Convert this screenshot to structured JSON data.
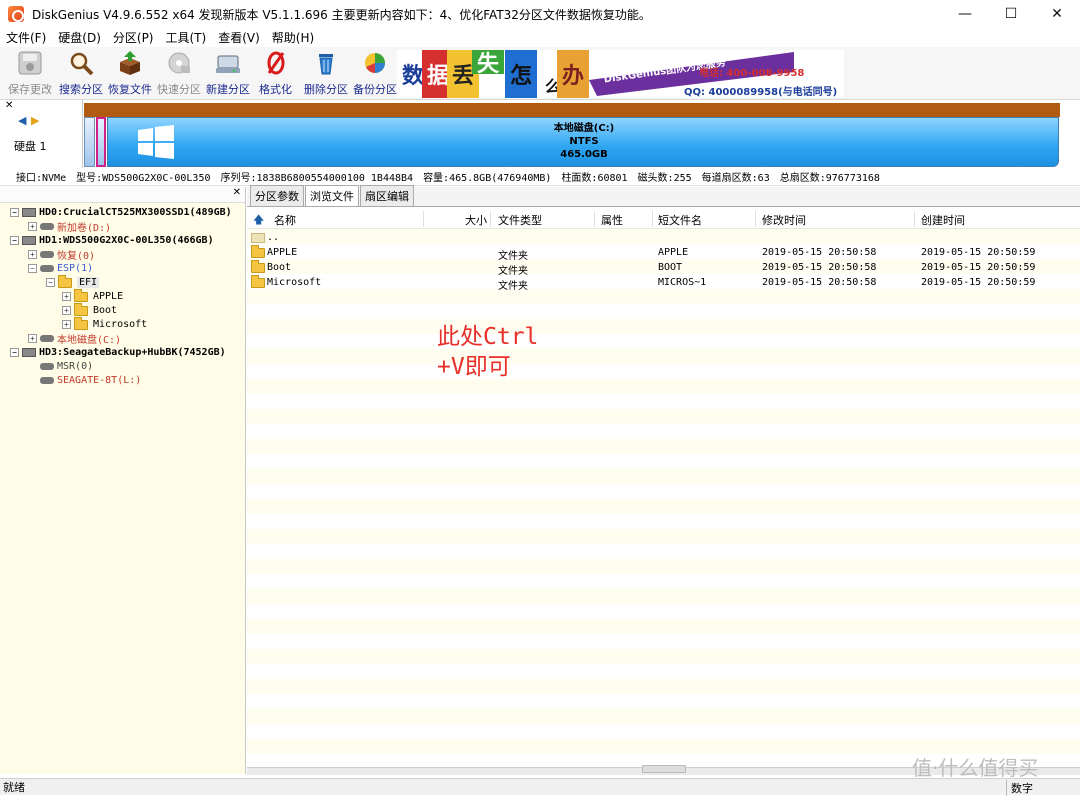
{
  "window": {
    "title": "DiskGenius V4.9.6.552 x64    发现新版本 V5.1.1.696 主要更新内容如下：4、优化FAT32分区文件数据恢复功能。",
    "min": "—",
    "max": "☐",
    "close": "✕"
  },
  "menu": [
    "文件(F)",
    "硬盘(D)",
    "分区(P)",
    "工具(T)",
    "查看(V)",
    "帮助(H)"
  ],
  "toolbar": {
    "save": "保存更改",
    "search": "搜索分区",
    "recover": "恢复文件",
    "quick": "快速分区",
    "new": "新建分区",
    "format": "格式化",
    "delete": "删除分区",
    "backup": "备份分区"
  },
  "banner": {
    "chars": [
      "数",
      "据",
      "丢",
      "失",
      "怎",
      "么",
      "办"
    ],
    "slogan": "DiskGenius团队为您服务",
    "phone": "电话: 400-008-9958",
    "qq": "QQ: 4000089958(与电话同号)"
  },
  "disk_label": "硬盘 1",
  "disk_nav": {
    "back": "◀",
    "forward": "▶"
  },
  "partition": {
    "name": "本地磁盘(C:)",
    "fs": "NTFS",
    "size": "465.0GB"
  },
  "disk_info": {
    "iface": "接口:NVMe",
    "model": "型号:WDS500G2X0C-00L350",
    "serial": "序列号:1838B6800554000100 1B448B4",
    "capacity": "容量:465.8GB(476940MB)",
    "cylinders": "柱面数:60801",
    "heads": "磁头数:255",
    "sectors_per_track": "每道扇区数:63",
    "total_sectors": "总扇区数:976773168"
  },
  "tree": {
    "hd0": "HD0:CrucialCT525MX300SSD1(489GB)",
    "hd0_p1": "新加卷(D:)",
    "hd1": "HD1:WDS500G2X0C-00L350(466GB)",
    "hd1_p1": "恢复(0)",
    "hd1_p2": "ESP(1)",
    "efi": "EFI",
    "apple": "APPLE",
    "boot": "Boot",
    "microsoft": "Microsoft",
    "hd1_p3": "本地磁盘(C:)",
    "hd3": "HD3:SeagateBackup+HubBK(7452GB)",
    "hd3_p1": "MSR(0)",
    "hd3_p2": "SEAGATE-8T(L:)"
  },
  "tabs": [
    "分区参数",
    "浏览文件",
    "扇区编辑"
  ],
  "columns": [
    "名称",
    "大小",
    "文件类型",
    "属性",
    "短文件名",
    "修改时间",
    "创建时间"
  ],
  "files": [
    {
      "name": "..",
      "size": "",
      "type": "",
      "attr": "",
      "short": "",
      "mtime": "",
      "ctime": ""
    },
    {
      "name": "APPLE",
      "size": "",
      "type": "文件夹",
      "attr": "",
      "short": "APPLE",
      "mtime": "2019-05-15 20:50:58",
      "ctime": "2019-05-15 20:50:59"
    },
    {
      "name": "Boot",
      "size": "",
      "type": "文件夹",
      "attr": "",
      "short": "BOOT",
      "mtime": "2019-05-15 20:50:58",
      "ctime": "2019-05-15 20:50:59"
    },
    {
      "name": "Microsoft",
      "size": "",
      "type": "文件夹",
      "attr": "",
      "short": "MICROS~1",
      "mtime": "2019-05-15 20:50:58",
      "ctime": "2019-05-15 20:50:59"
    }
  ],
  "annotation": {
    "line1": "此处Ctrl",
    "line2": "+V即可"
  },
  "status": {
    "left": "就绪",
    "right": "数字"
  },
  "watermark": "值·什么值得买"
}
